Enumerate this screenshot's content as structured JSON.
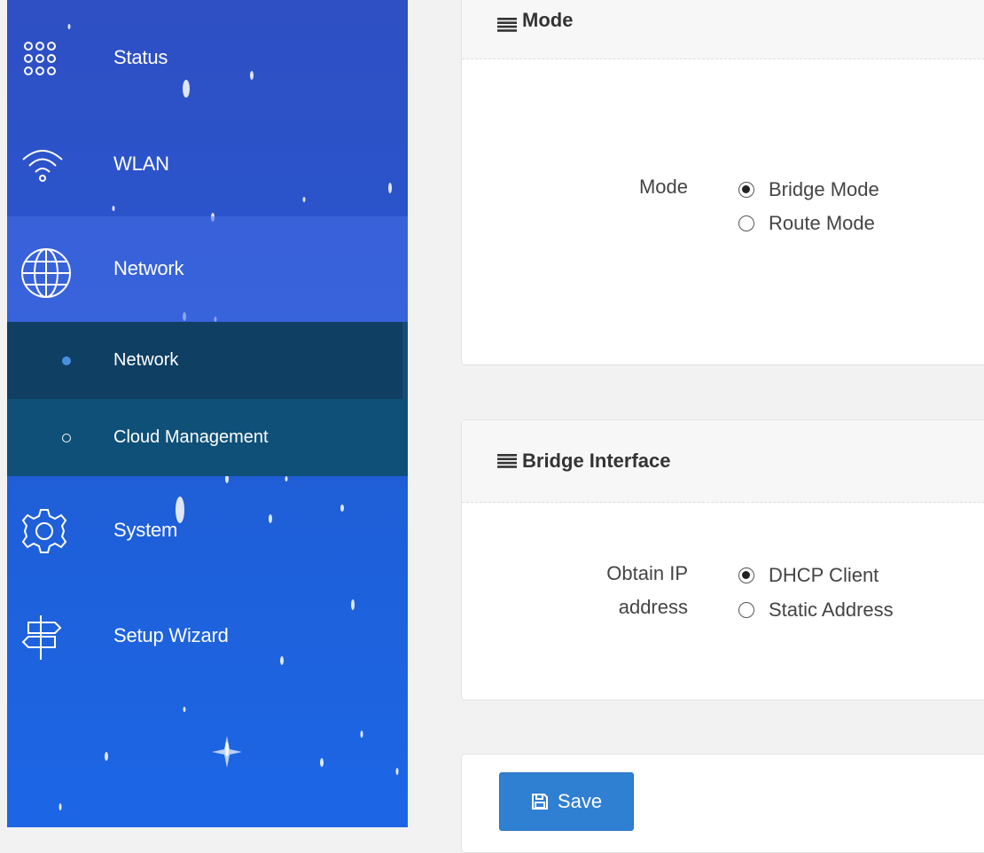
{
  "sidebar": {
    "items": [
      {
        "label": "Status",
        "icon": "grid-dots-icon"
      },
      {
        "label": "WLAN",
        "icon": "wifi-icon"
      },
      {
        "label": "Network",
        "icon": "globe-icon"
      },
      {
        "label": "System",
        "icon": "gear-icon"
      },
      {
        "label": "Setup Wizard",
        "icon": "signpost-icon"
      }
    ],
    "subitems": [
      {
        "label": "Network",
        "active": true
      },
      {
        "label": "Cloud Management",
        "active": false
      }
    ]
  },
  "mode_panel": {
    "title": "Mode",
    "field_label": "Mode",
    "options": [
      {
        "label": "Bridge Mode",
        "checked": true
      },
      {
        "label": "Route Mode",
        "checked": false
      }
    ]
  },
  "bridge_panel": {
    "title": "Bridge Interface",
    "field_label_line1": "Obtain IP",
    "field_label_line2": "address",
    "options": [
      {
        "label": "DHCP Client",
        "checked": true
      },
      {
        "label": "Static Address",
        "checked": false
      }
    ]
  },
  "actions": {
    "save_label": "Save"
  },
  "colors": {
    "sidebar_top": "#2f4fc4",
    "sidebar_bottom": "#1c66e6",
    "submenu_active": "#0f3f63",
    "submenu_inactive": "#0f5078",
    "save_button": "#2f7fd2"
  }
}
